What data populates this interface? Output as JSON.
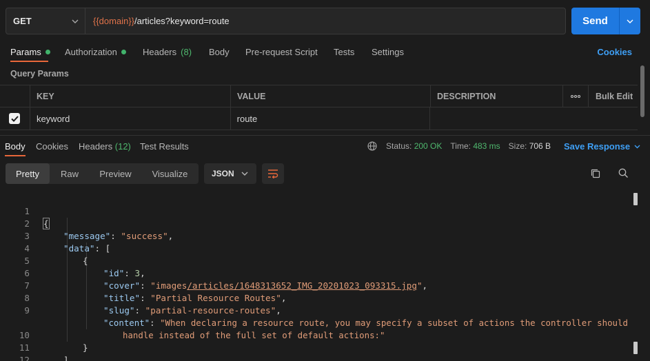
{
  "request": {
    "method": "GET",
    "url_var": "{{domain}}",
    "url_rest": "/articles?keyword=route",
    "send_label": "Send"
  },
  "request_tabs": {
    "params": "Params",
    "authorization": "Authorization",
    "headers": "Headers",
    "headers_count": "(8)",
    "body": "Body",
    "prerequest": "Pre-request Script",
    "tests": "Tests",
    "settings": "Settings",
    "cookies": "Cookies"
  },
  "query_params": {
    "label": "Query Params",
    "columns": {
      "key": "KEY",
      "value": "VALUE",
      "description": "DESCRIPTION",
      "bulk_edit": "Bulk Edit"
    },
    "rows": [
      {
        "checked": true,
        "key": "keyword",
        "value": "route",
        "description": ""
      }
    ]
  },
  "response_tabs": {
    "body": "Body",
    "cookies": "Cookies",
    "headers": "Headers",
    "headers_count": "(12)",
    "test_results": "Test Results"
  },
  "status": {
    "status_label": "Status:",
    "status_value": "200 OK",
    "time_label": "Time:",
    "time_value": "483 ms",
    "size_label": "Size:",
    "size_value": "706 B",
    "save_response": "Save Response"
  },
  "viewer": {
    "modes": [
      "Pretty",
      "Raw",
      "Preview",
      "Visualize"
    ],
    "active_mode": "Pretty",
    "format": "JSON"
  },
  "response_body": {
    "line_numbers": [
      "1",
      "2",
      "3",
      "4",
      "5",
      "6",
      "7",
      "8",
      "9",
      "",
      "10",
      "11",
      "12"
    ],
    "message_key": "\"message\"",
    "message_value": "\"success\"",
    "data_key": "\"data\"",
    "id_key": "\"id\"",
    "id_value": "3",
    "cover_key": "\"cover\"",
    "cover_value_prefix": "\"images",
    "cover_value_link": "/articles/1648313652_IMG_20201023_093315.jpg",
    "cover_value_suffix": "\"",
    "title_key": "\"title\"",
    "title_value": "\"Partial Resource Routes\"",
    "slug_key": "\"slug\"",
    "slug_value": "\"partial-resource-routes\"",
    "content_key": "\"content\"",
    "content_value_line1": "\"When declaring a resource route, you may specify a subset of actions the controller should",
    "content_value_line2": "handle instead of the full set of default actions:\""
  },
  "colors": {
    "accent": "#e8673a",
    "send": "#1f79e0",
    "link": "#3e9ff5",
    "success": "#4fb86e",
    "json_key": "#9cc9f0",
    "json_string": "#e09c78",
    "json_number": "#b5cea8"
  }
}
